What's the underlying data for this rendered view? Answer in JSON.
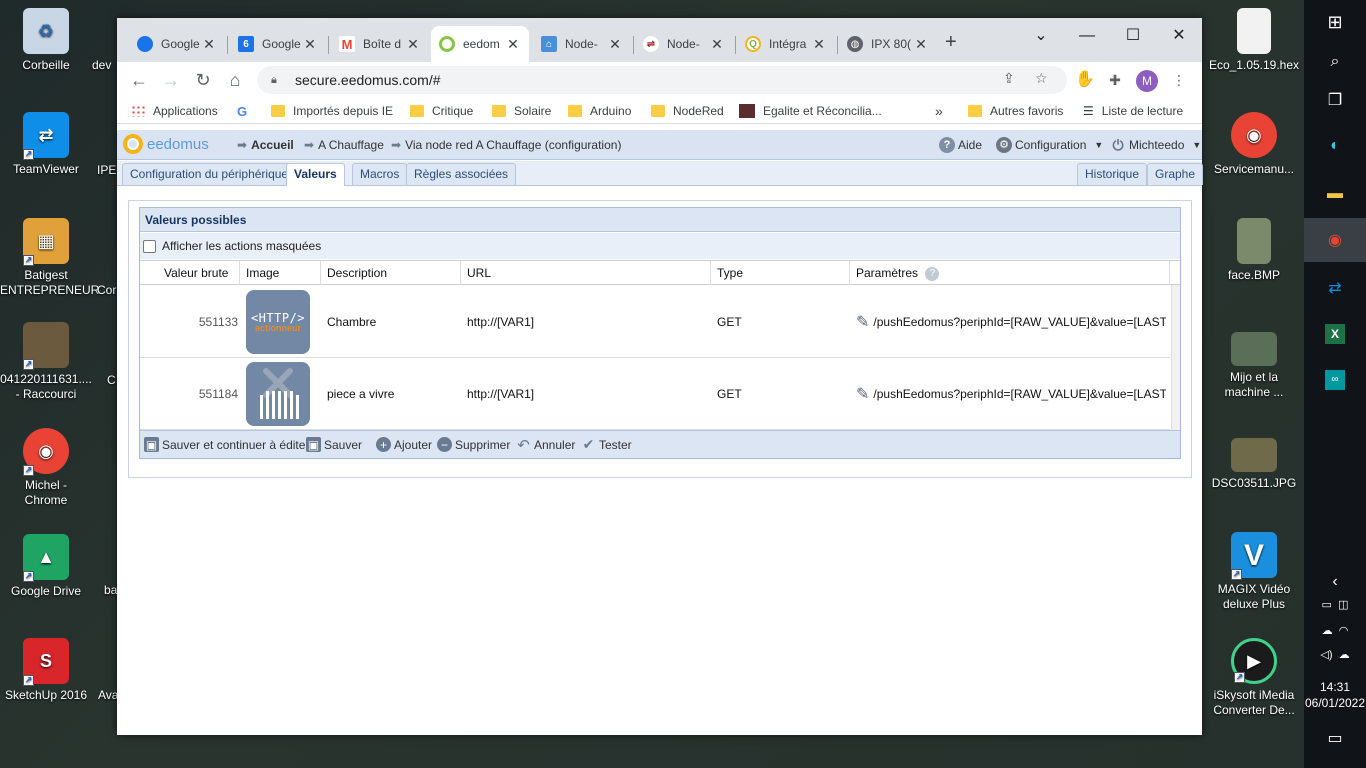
{
  "desktop": {
    "left_icons": [
      {
        "label": "Corbeille",
        "icon": "recycle-bin-icon",
        "color": "#c9d6e6",
        "glyph": "♻"
      },
      {
        "label": "TeamViewer",
        "icon": "teamviewer-icon",
        "color": "#0e8ee9",
        "glyph": "⇄"
      },
      {
        "label": "Batigest\nENTREPRENEUR",
        "icon": "batigest-icon",
        "color": "#e1a13a",
        "glyph": "▦"
      },
      {
        "label": "041220111631....\n- Raccourci",
        "icon": "photo-shortcut-icon",
        "color": "#6b5a3e",
        "glyph": ""
      },
      {
        "label": "Michel -\nChrome",
        "icon": "chrome-icon",
        "color": "#e84335",
        "glyph": "◉"
      },
      {
        "label": "Google Drive",
        "icon": "google-drive-icon",
        "color": "#1fa463",
        "glyph": "▲"
      },
      {
        "label": "SketchUp 2016",
        "icon": "sketchup-icon",
        "color": "#d8262b",
        "glyph": "S"
      }
    ],
    "left_partial": [
      "dev",
      "IPE",
      "Cor",
      "C",
      "",
      "ba",
      "Ava"
    ],
    "right_icons": [
      {
        "label": "Eco_1.05.19.hex",
        "icon": "file-icon",
        "color": "#f2f2f2",
        "glyph": ""
      },
      {
        "label": "Servicemanu...",
        "icon": "chrome-icon",
        "color": "#e84335",
        "glyph": "◉"
      },
      {
        "label": "face.BMP",
        "icon": "image-icon",
        "color": "#7a8a6a",
        "glyph": ""
      },
      {
        "label": "Mijo et la\nmachine ...",
        "icon": "image-icon",
        "color": "#5b6e58",
        "glyph": ""
      },
      {
        "label": "DSC03511.JPG",
        "icon": "image-icon",
        "color": "#6e6a4a",
        "glyph": ""
      },
      {
        "label": "MAGIX Vidéo\ndeluxe Plus",
        "icon": "magix-icon",
        "color": "#1a8fdd",
        "glyph": "V"
      },
      {
        "label": "iSkysoft iMedia\nConverter De...",
        "icon": "iskysoft-icon",
        "color": "#1b1b1b",
        "glyph": "▶"
      }
    ]
  },
  "taskbar": {
    "time": "14:31",
    "date": "06/01/2022"
  },
  "browser": {
    "tabs": [
      {
        "title": "Google",
        "fav_color": "#1a73e8",
        "fav_glyph": "●"
      },
      {
        "title": "Google",
        "fav_color": "#1a73e8",
        "fav_glyph": "6"
      },
      {
        "title": "Boîte d",
        "fav_color": "#ea4335",
        "fav_glyph": "M"
      },
      {
        "title": "eedom",
        "fav_color": "#f5b31b",
        "fav_glyph": "○"
      },
      {
        "title": "Node-",
        "fav_color": "#4a90d9",
        "fav_glyph": "⌂"
      },
      {
        "title": "Node-",
        "fav_color": "#8f0000",
        "fav_glyph": "⇌"
      },
      {
        "title": "Intégra",
        "fav_color": "#7cb342",
        "fav_glyph": "Q"
      },
      {
        "title": "IPX 80(",
        "fav_color": "#5f6368",
        "fav_glyph": "◍"
      }
    ],
    "url": "secure.eedomus.com/#",
    "profile_initial": "M",
    "bookmarks": [
      {
        "label": "Applications",
        "type": "apps"
      },
      {
        "label": "",
        "type": "google"
      },
      {
        "label": "Importés depuis IE",
        "type": "folder"
      },
      {
        "label": "Critique",
        "type": "folder"
      },
      {
        "label": "Solaire",
        "type": "folder"
      },
      {
        "label": "Arduino",
        "type": "folder"
      },
      {
        "label": "NodeRed",
        "type": "folder"
      },
      {
        "label": "Egalite et Réconcilia...",
        "type": "site"
      }
    ],
    "bookmarks_more": "»",
    "other_bookmarks": "Autres favoris",
    "reading_list": "Liste de lecture"
  },
  "eedomus": {
    "logo_text": "eedomus",
    "breadcrumb": [
      "Accueil",
      "A Chauffage",
      "Via node red A Chauffage (configuration)"
    ],
    "help": "Aide",
    "configuration": "Configuration",
    "user": "Michteedo",
    "tabs": [
      "Configuration du périphérique",
      "Valeurs",
      "Macros",
      "Règles associées"
    ],
    "right_tabs": [
      "Historique",
      "Graphe"
    ],
    "panel_title": "Valeurs possibles",
    "show_hidden": "Afficher les actions masquées",
    "columns": [
      "Valeur brute",
      "Image",
      "Description",
      "URL",
      "Type",
      "Paramètres"
    ],
    "rows": [
      {
        "raw": "551133",
        "image": "http-actionneur",
        "image_text": "<HTTP/>",
        "image_sub": "actionneur",
        "description": "Chambre",
        "url": "http://[VAR1]",
        "type": "GET",
        "params": "/pushEedomus?periphId=[RAW_VALUE]&value=[LAST_..."
      },
      {
        "raw": "551184",
        "image": "radiator-off",
        "image_text": "",
        "image_sub": "",
        "description": "piece a vivre",
        "url": "http://[VAR1]",
        "type": "GET",
        "params": "/pushEedomus?periphId=[RAW_VALUE]&value=[LAST_..."
      }
    ],
    "actions": [
      "Sauver et continuer à éditer",
      "Sauver",
      "Ajouter",
      "Supprimer",
      "Annuler",
      "Tester"
    ]
  }
}
